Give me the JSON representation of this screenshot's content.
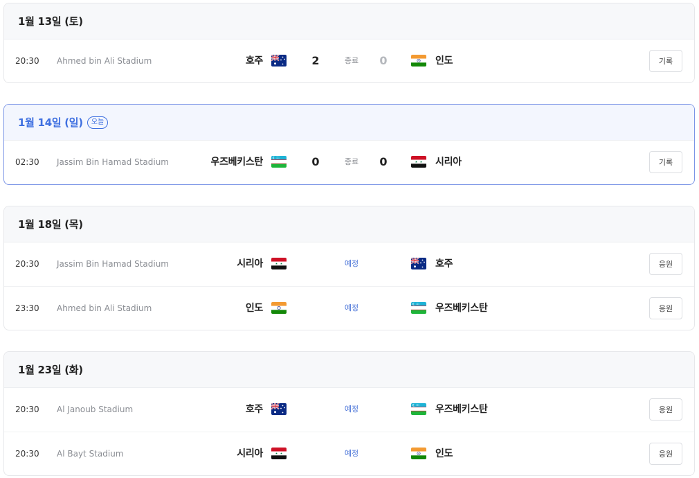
{
  "days": [
    {
      "date_label": "1월 13일 (토)",
      "is_today": false,
      "today_badge": "",
      "matches": [
        {
          "time": "20:30",
          "stadium": "Ahmed bin Ali Stadium",
          "home_team": "호주",
          "home_flag": "australia",
          "home_score": "2",
          "status": "종료",
          "away_score": "0",
          "away_team": "인도",
          "away_flag": "india",
          "action_label": "기록",
          "finished": true,
          "away_lost": true
        }
      ]
    },
    {
      "date_label": "1월 14일 (일)",
      "is_today": true,
      "today_badge": "오늘",
      "matches": [
        {
          "time": "02:30",
          "stadium": "Jassim Bin Hamad Stadium",
          "home_team": "우즈베키스탄",
          "home_flag": "uzbekistan",
          "home_score": "0",
          "status": "종료",
          "away_score": "0",
          "away_team": "시리아",
          "away_flag": "syria",
          "action_label": "기록",
          "finished": true,
          "away_lost": false
        }
      ]
    },
    {
      "date_label": "1월 18일 (목)",
      "is_today": false,
      "today_badge": "",
      "matches": [
        {
          "time": "20:30",
          "stadium": "Jassim Bin Hamad Stadium",
          "home_team": "시리아",
          "home_flag": "syria",
          "home_score": "",
          "status": "예정",
          "away_score": "",
          "away_team": "호주",
          "away_flag": "australia",
          "action_label": "응원",
          "finished": false,
          "away_lost": false
        },
        {
          "time": "23:30",
          "stadium": "Ahmed bin Ali Stadium",
          "home_team": "인도",
          "home_flag": "india",
          "home_score": "",
          "status": "예정",
          "away_score": "",
          "away_team": "우즈베키스탄",
          "away_flag": "uzbekistan",
          "action_label": "응원",
          "finished": false,
          "away_lost": false
        }
      ]
    },
    {
      "date_label": "1월 23일 (화)",
      "is_today": false,
      "today_badge": "",
      "matches": [
        {
          "time": "20:30",
          "stadium": "Al Janoub Stadium",
          "home_team": "호주",
          "home_flag": "australia",
          "home_score": "",
          "status": "예정",
          "away_score": "",
          "away_team": "우즈베키스탄",
          "away_flag": "uzbekistan",
          "action_label": "응원",
          "finished": false,
          "away_lost": false
        },
        {
          "time": "20:30",
          "stadium": "Al Bayt Stadium",
          "home_team": "시리아",
          "home_flag": "syria",
          "home_score": "",
          "status": "예정",
          "away_score": "",
          "away_team": "인도",
          "away_flag": "india",
          "action_label": "응원",
          "finished": false,
          "away_lost": false
        }
      ]
    }
  ],
  "colors": {
    "accent": "#3e6fe0",
    "scheduled": "#4a74d8",
    "muted": "#8a8d93",
    "border": "#e6e7ea",
    "today_border": "#7b95e6"
  }
}
